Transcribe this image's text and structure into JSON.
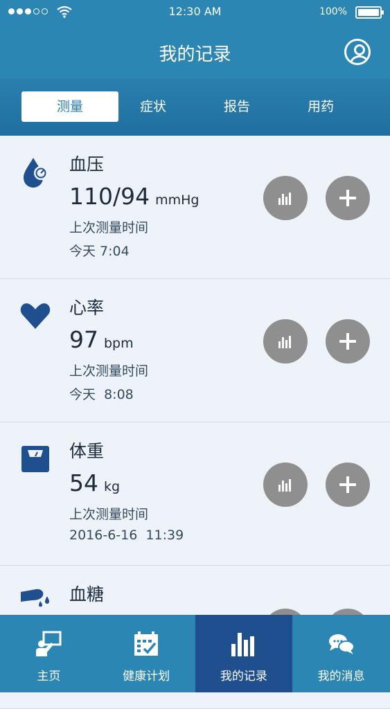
{
  "status": {
    "time": "12:30 AM",
    "battery": "100%"
  },
  "header": {
    "title": "我的记录"
  },
  "tabs": [
    {
      "label": "测量"
    },
    {
      "label": "症状"
    },
    {
      "label": "报告"
    },
    {
      "label": "用药"
    }
  ],
  "records": [
    {
      "name": "血压",
      "value": "110/94",
      "unit": "mmHg",
      "last_label": "上次测量时间",
      "last_time": "今天 7:04",
      "icon": "blood-drop-gauge-icon"
    },
    {
      "name": "心率",
      "value": "97",
      "unit": "bpm",
      "last_label": "上次测量时间",
      "last_time": "今天  8:08",
      "icon": "heart-icon"
    },
    {
      "name": "体重",
      "value": "54",
      "unit": "kg",
      "last_label": "上次测量时间",
      "last_time": "2016-6-16  11:39",
      "icon": "scale-icon"
    },
    {
      "name": "血糖",
      "icon": "finger-drop-icon"
    }
  ],
  "nav": [
    {
      "label": "主页",
      "icon": "home-board-icon"
    },
    {
      "label": "健康计划",
      "icon": "calendar-check-icon"
    },
    {
      "label": "我的记录",
      "icon": "bar-chart-icon"
    },
    {
      "label": "我的消息",
      "icon": "chat-bubbles-icon"
    }
  ],
  "colors": {
    "primary": "#2c86b3",
    "nav_active": "#1f4f8f",
    "icon_blue": "#1f4f8f",
    "button_gray": "#8f8f8f"
  }
}
